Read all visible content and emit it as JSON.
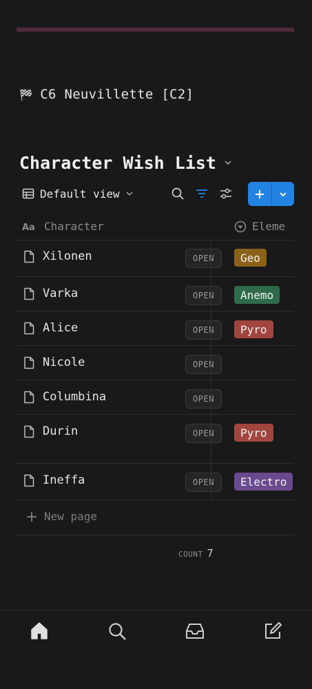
{
  "colors": {
    "background": "#191919",
    "accent": "#2383e2",
    "cover_bar": "#4e2a3b",
    "tag_geo": "#8a6219",
    "tag_anemo": "#2f6b4b",
    "tag_pyro": "#a2453f",
    "tag_electro": "#6a4a8e"
  },
  "page": {
    "icon": "🏁",
    "title": "C6 Neuvillette [C2]"
  },
  "database": {
    "title": "Character Wish List",
    "view_label": "Default view"
  },
  "table": {
    "columns": {
      "character": "Character",
      "element": "Eleme"
    },
    "open_label": "OPEN",
    "rows": [
      {
        "name": "Xilonen",
        "element": "Geo",
        "color": "#8a6219"
      },
      {
        "name": "Varka",
        "element": "Anemo",
        "color": "#2f6b4b"
      },
      {
        "name": "Alice",
        "element": "Pyro",
        "color": "#a2453f"
      },
      {
        "name": "Nicole",
        "element": "",
        "color": ""
      },
      {
        "name": "Columbina",
        "element": "",
        "color": ""
      },
      {
        "name": "Durin",
        "element": "Pyro",
        "color": "#a2453f"
      },
      {
        "name": "Ineffa",
        "element": "Electro",
        "color": "#6a4a8e"
      }
    ],
    "new_page_label": "New page",
    "count_label": "COUNT",
    "count_value": "7"
  },
  "icons": {
    "page_icon": "document-icon",
    "nav": [
      "home-icon",
      "search-icon",
      "inbox-icon",
      "compose-icon"
    ]
  }
}
